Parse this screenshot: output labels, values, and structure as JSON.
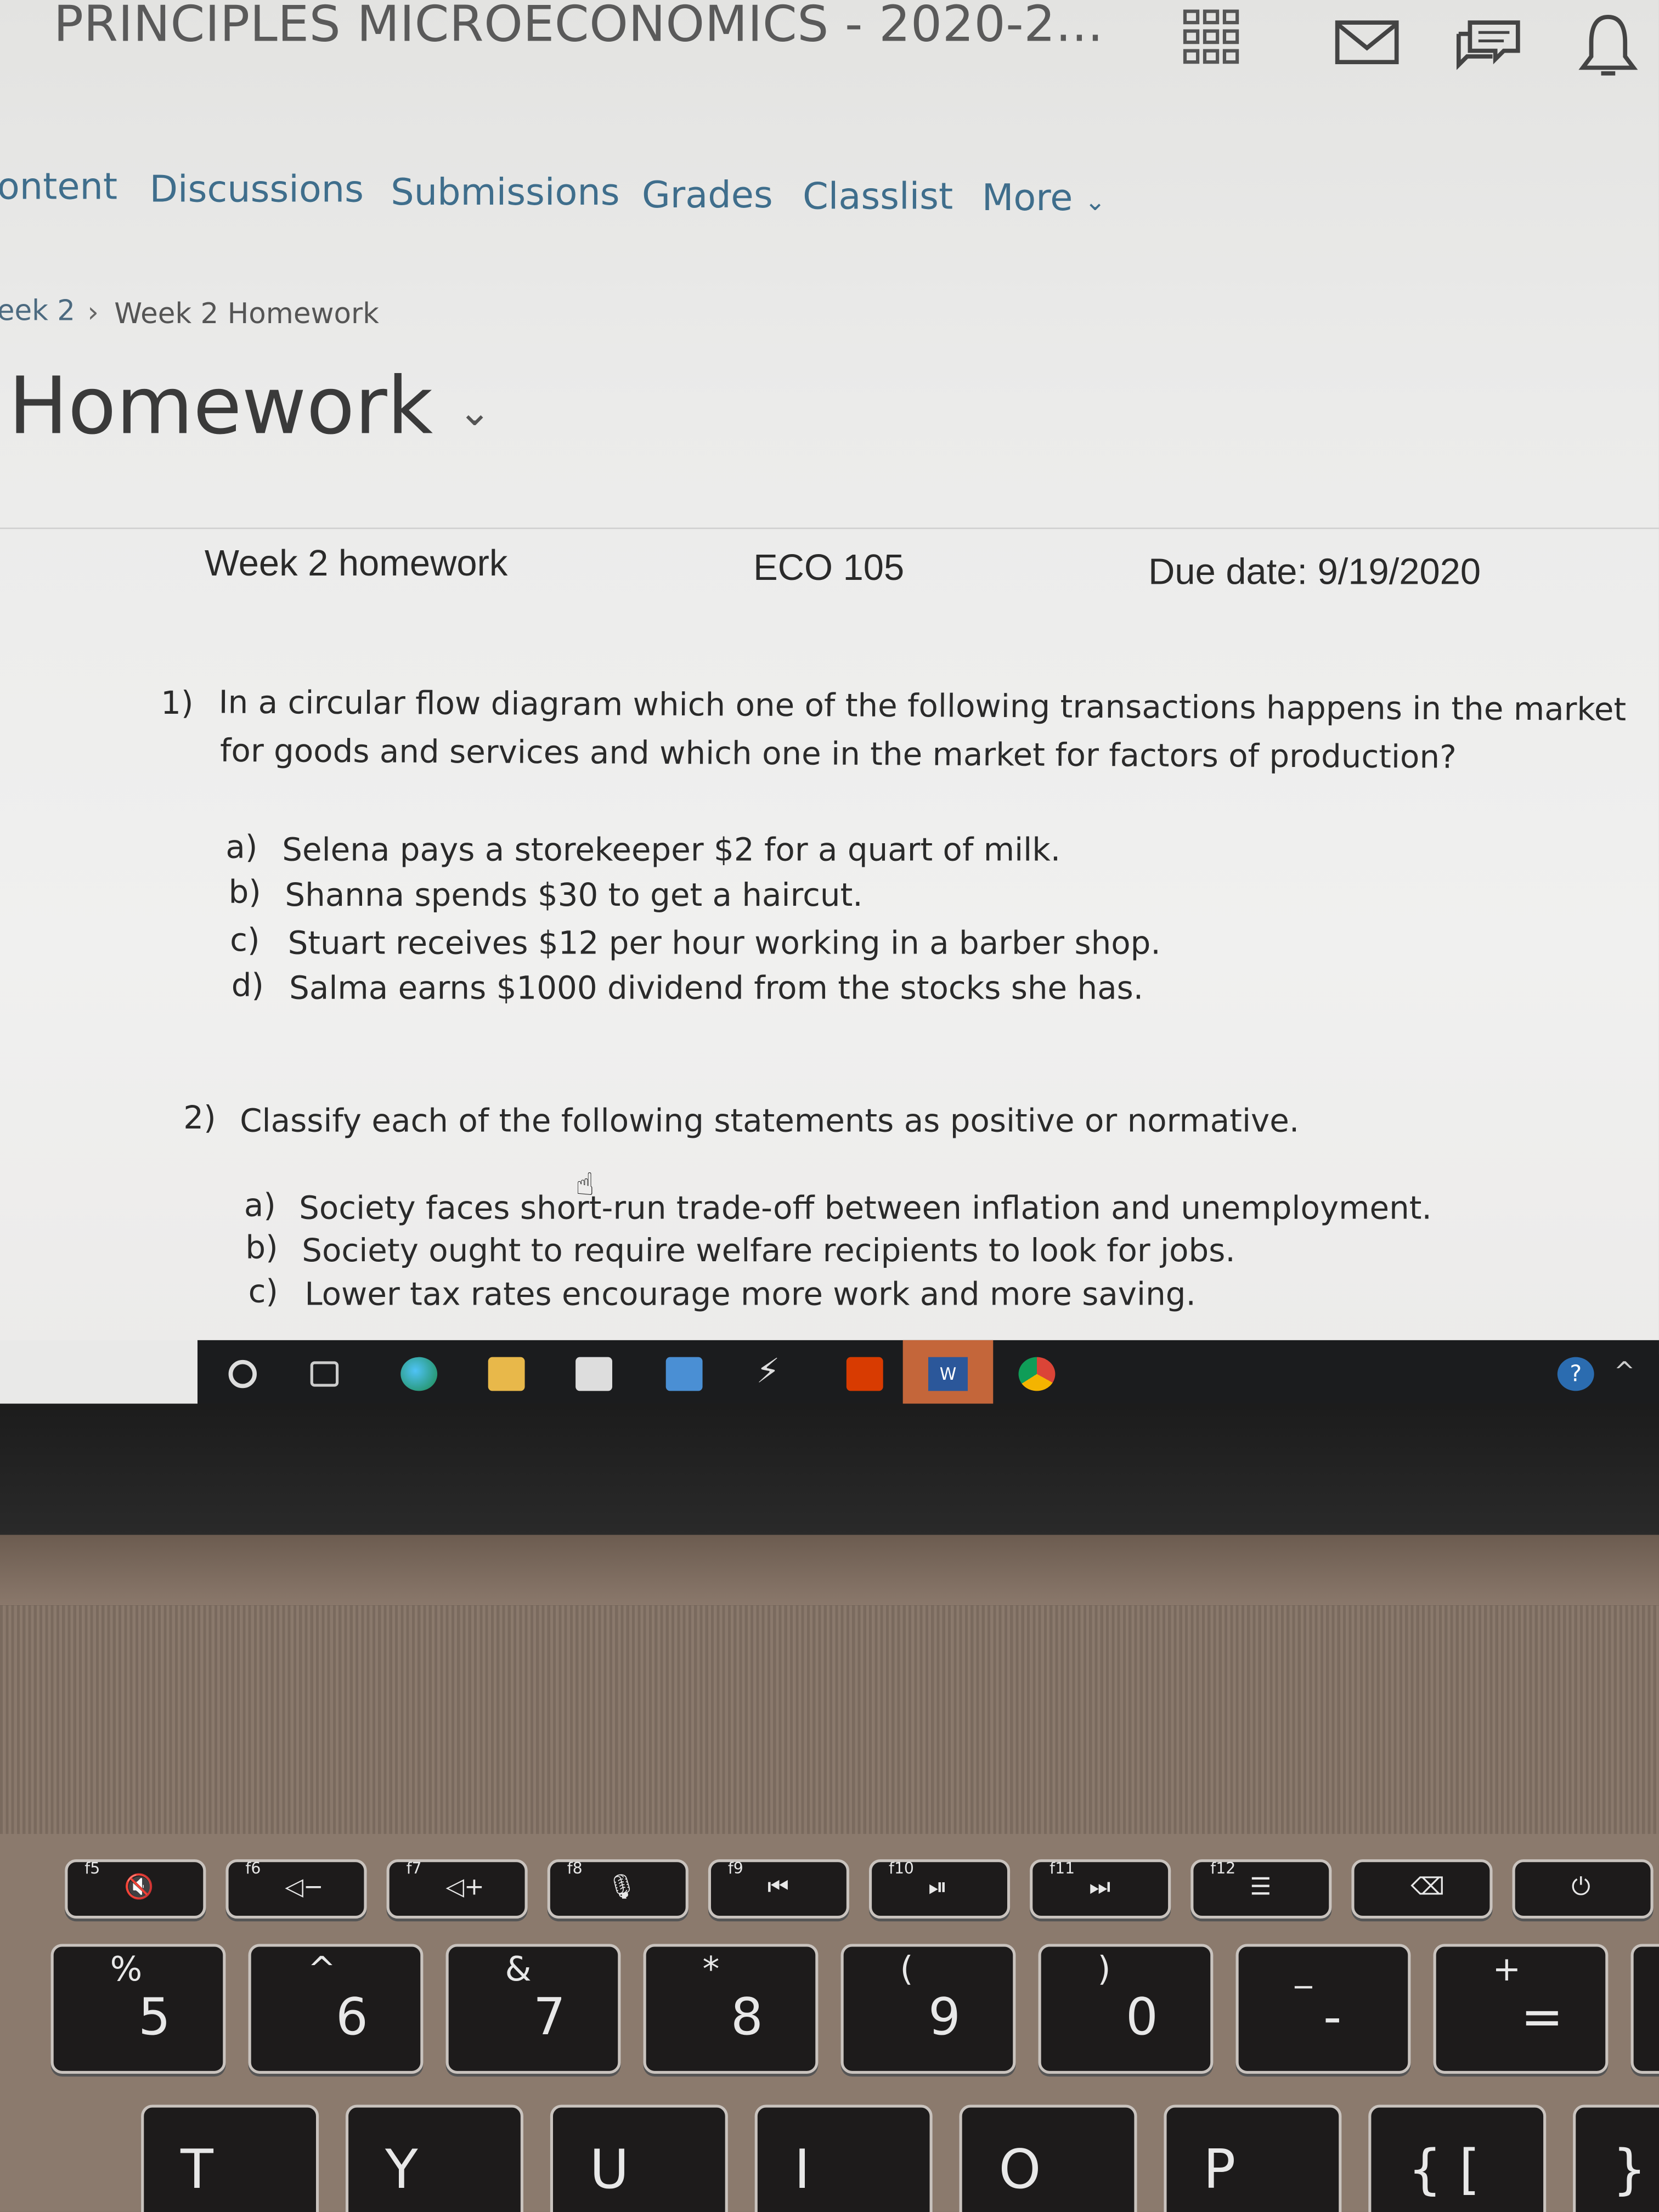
{
  "header": {
    "course_title": "PRINCIPLES MICROECONOMICS - 2020-2...",
    "icons": [
      "app-grid-icon",
      "mail-icon",
      "chat-icon",
      "bell-icon"
    ]
  },
  "nav": {
    "items": [
      "ontent",
      "Discussions",
      "Submissions",
      "Grades",
      "Classlist",
      "More"
    ]
  },
  "breadcrumb": {
    "parent": "eek 2",
    "separator": "›",
    "current": "Week 2 Homework"
  },
  "page_title": "Homework",
  "document": {
    "header": {
      "left": "Week 2 homework",
      "center": "ECO 105",
      "right": "Due date: 9/19/2020"
    },
    "questions": [
      {
        "number": "1)",
        "text_line1": "In a circular flow diagram which one of the following transactions happens in the market",
        "text_line2": "for goods and services and which one in the market for factors of production?",
        "options": [
          {
            "label": "a)",
            "text": "Selena pays a storekeeper $2 for a quart of milk."
          },
          {
            "label": "b)",
            "text": "Shanna spends $30 to get a haircut."
          },
          {
            "label": "c)",
            "text": "Stuart receives $12 per hour working in a barber shop."
          },
          {
            "label": "d)",
            "text": "Salma earns $1000 dividend from the stocks she has."
          }
        ]
      },
      {
        "number": "2)",
        "text_line1": "Classify each of the following statements as positive or normative.",
        "options": [
          {
            "label": "a)",
            "text": "Society faces short-run trade-off between inflation and unemployment."
          },
          {
            "label": "b)",
            "text": "Society ought to require welfare recipients to look for jobs."
          },
          {
            "label": "c)",
            "text": "Lower tax rates encourage more work and more saving."
          }
        ]
      }
    ]
  },
  "taskbar": {
    "icons": [
      "search-icon",
      "task-view-icon",
      "edge-icon",
      "file-explorer-icon",
      "store-icon",
      "mail-icon",
      "power-automate-icon",
      "office-icon",
      "word-icon",
      "chrome-icon"
    ],
    "word_label": "W",
    "help": "?"
  },
  "keyboard": {
    "fn_row": [
      {
        "fn": "f5",
        "sym": "🔇"
      },
      {
        "fn": "f6",
        "sym": "◁−"
      },
      {
        "fn": "f7",
        "sym": "◁+"
      },
      {
        "fn": "f8",
        "sym": "🎙"
      },
      {
        "fn": "f9",
        "sym": "⏮"
      },
      {
        "fn": "f10",
        "sym": "⏯"
      },
      {
        "fn": "f11",
        "sym": "⏭"
      },
      {
        "fn": "f12",
        "sym": "☰"
      },
      {
        "fn": "",
        "sym": "⌫"
      },
      {
        "fn": "",
        "sym": "⏻"
      }
    ],
    "num_row": [
      {
        "top": "%",
        "main": "5"
      },
      {
        "top": "^",
        "main": "6"
      },
      {
        "top": "&",
        "main": "7"
      },
      {
        "top": "*",
        "main": "8"
      },
      {
        "top": "(",
        "main": "9"
      },
      {
        "top": ")",
        "main": "0"
      },
      {
        "top": "_",
        "main": "-"
      },
      {
        "top": "+",
        "main": "="
      },
      {
        "top": "",
        "main": "←"
      }
    ],
    "letter_row": [
      "T",
      "Y",
      "U",
      "I",
      "O",
      "P",
      "{ [",
      "} ]"
    ]
  }
}
